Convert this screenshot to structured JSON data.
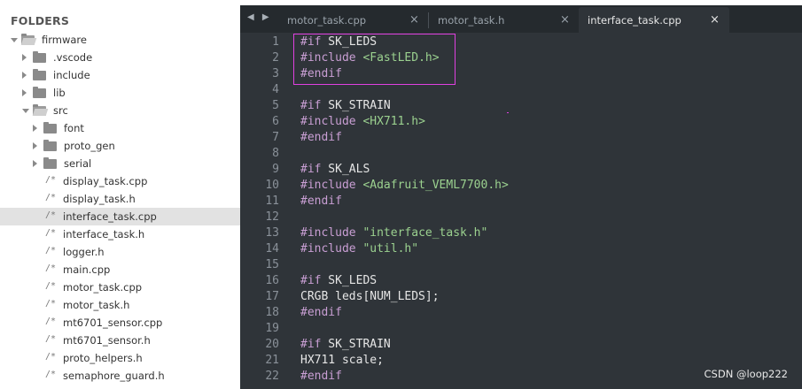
{
  "sidebar": {
    "header": "FOLDERS",
    "tree": [
      {
        "label": "firmware",
        "kind": "folder",
        "state": "expanded",
        "depth": 0
      },
      {
        "label": ".vscode",
        "kind": "folder",
        "state": "collapsed",
        "depth": 1
      },
      {
        "label": "include",
        "kind": "folder",
        "state": "collapsed",
        "depth": 1
      },
      {
        "label": "lib",
        "kind": "folder",
        "state": "collapsed",
        "depth": 1
      },
      {
        "label": "src",
        "kind": "folder",
        "state": "expanded",
        "depth": 1
      },
      {
        "label": "font",
        "kind": "folder",
        "state": "collapsed",
        "depth": 2
      },
      {
        "label": "proto_gen",
        "kind": "folder",
        "state": "collapsed",
        "depth": 2
      },
      {
        "label": "serial",
        "kind": "folder",
        "state": "collapsed",
        "depth": 2
      },
      {
        "label": "display_task.cpp",
        "kind": "file",
        "depth": 2
      },
      {
        "label": "display_task.h",
        "kind": "file",
        "depth": 2
      },
      {
        "label": "interface_task.cpp",
        "kind": "file",
        "depth": 2,
        "selected": true
      },
      {
        "label": "interface_task.h",
        "kind": "file",
        "depth": 2
      },
      {
        "label": "logger.h",
        "kind": "file",
        "depth": 2
      },
      {
        "label": "main.cpp",
        "kind": "file",
        "depth": 2
      },
      {
        "label": "motor_task.cpp",
        "kind": "file",
        "depth": 2
      },
      {
        "label": "motor_task.h",
        "kind": "file",
        "depth": 2
      },
      {
        "label": "mt6701_sensor.cpp",
        "kind": "file",
        "depth": 2
      },
      {
        "label": "mt6701_sensor.h",
        "kind": "file",
        "depth": 2
      },
      {
        "label": "proto_helpers.h",
        "kind": "file",
        "depth": 2
      },
      {
        "label": "semaphore_guard.h",
        "kind": "file",
        "depth": 2
      }
    ],
    "file_icon_glyph": "/*"
  },
  "tabs": {
    "nav_arrows": "◀ ▶",
    "close_glyph": "×",
    "items": [
      {
        "label": "motor_task.cpp",
        "active": false
      },
      {
        "label": "motor_task.h",
        "active": false
      },
      {
        "label": "interface_task.cpp",
        "active": true
      }
    ]
  },
  "editor": {
    "lines": [
      {
        "n": "1",
        "tokens": [
          {
            "t": "#if",
            "c": "pp"
          },
          {
            "t": " SK_LEDS",
            "c": "plain"
          }
        ]
      },
      {
        "n": "2",
        "tokens": [
          {
            "t": "#include",
            "c": "pp"
          },
          {
            "t": " ",
            "c": "plain"
          },
          {
            "t": "<FastLED.h>",
            "c": "str"
          }
        ]
      },
      {
        "n": "3",
        "tokens": [
          {
            "t": "#endif",
            "c": "pp"
          }
        ]
      },
      {
        "n": "4",
        "tokens": []
      },
      {
        "n": "5",
        "tokens": [
          {
            "t": "#if",
            "c": "pp"
          },
          {
            "t": " SK_STRAIN",
            "c": "plain"
          }
        ]
      },
      {
        "n": "6",
        "tokens": [
          {
            "t": "#include",
            "c": "pp"
          },
          {
            "t": " ",
            "c": "plain"
          },
          {
            "t": "<HX711.h>",
            "c": "str"
          }
        ]
      },
      {
        "n": "7",
        "tokens": [
          {
            "t": "#endif",
            "c": "pp"
          }
        ]
      },
      {
        "n": "8",
        "tokens": []
      },
      {
        "n": "9",
        "tokens": [
          {
            "t": "#if",
            "c": "pp"
          },
          {
            "t": " SK_ALS",
            "c": "plain"
          }
        ]
      },
      {
        "n": "10",
        "tokens": [
          {
            "t": "#include",
            "c": "pp"
          },
          {
            "t": " ",
            "c": "plain"
          },
          {
            "t": "<Adafruit_VEML7700.h>",
            "c": "str"
          }
        ]
      },
      {
        "n": "11",
        "tokens": [
          {
            "t": "#endif",
            "c": "pp"
          }
        ]
      },
      {
        "n": "12",
        "tokens": []
      },
      {
        "n": "13",
        "tokens": [
          {
            "t": "#include",
            "c": "pp"
          },
          {
            "t": " ",
            "c": "plain"
          },
          {
            "t": "\"interface_task.h\"",
            "c": "str"
          }
        ]
      },
      {
        "n": "14",
        "tokens": [
          {
            "t": "#include",
            "c": "pp"
          },
          {
            "t": " ",
            "c": "plain"
          },
          {
            "t": "\"util.h\"",
            "c": "str"
          }
        ]
      },
      {
        "n": "15",
        "tokens": []
      },
      {
        "n": "16",
        "tokens": [
          {
            "t": "#if",
            "c": "pp"
          },
          {
            "t": " SK_LEDS",
            "c": "plain"
          }
        ]
      },
      {
        "n": "17",
        "tokens": [
          {
            "t": "CRGB leds[NUM_LEDS];",
            "c": "plain"
          }
        ]
      },
      {
        "n": "18",
        "tokens": [
          {
            "t": "#endif",
            "c": "pp"
          }
        ]
      },
      {
        "n": "19",
        "tokens": []
      },
      {
        "n": "20",
        "tokens": [
          {
            "t": "#if",
            "c": "pp"
          },
          {
            "t": " SK_STRAIN",
            "c": "plain"
          }
        ]
      },
      {
        "n": "21",
        "tokens": [
          {
            "t": "HX711 scale;",
            "c": "plain"
          }
        ]
      },
      {
        "n": "22",
        "tokens": [
          {
            "t": "#endif",
            "c": "pp"
          }
        ]
      }
    ]
  },
  "watermark": "CSDN @loop222",
  "colors": {
    "sidebar_bg": "#ffffff",
    "selected_row": "#e2e2e2",
    "editor_bg": "#2f3439",
    "tabbar_bg": "#252a2e",
    "preprocessor": "#c99fd4",
    "string": "#9bd18f",
    "highlight_box": "#e040e0"
  }
}
